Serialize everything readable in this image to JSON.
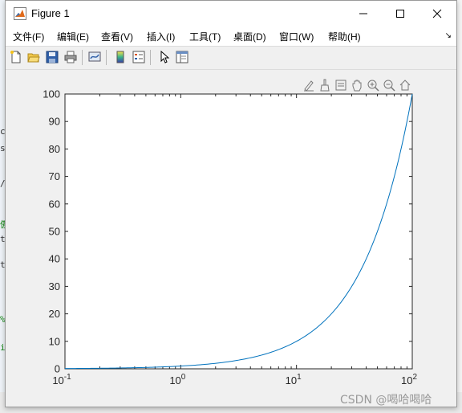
{
  "window": {
    "title": "Figure 1",
    "buttons": {
      "minimize_icon": "minimize-icon",
      "maximize_icon": "maximize-icon",
      "close_icon": "close-icon"
    }
  },
  "menubar": {
    "items": [
      {
        "label": "文件(F)"
      },
      {
        "label": "编辑(E)"
      },
      {
        "label": "查看(V)"
      },
      {
        "label": "插入(I)"
      },
      {
        "label": "工具(T)"
      },
      {
        "label": "桌面(D)"
      },
      {
        "label": "窗口(W)"
      },
      {
        "label": "帮助(H)"
      }
    ]
  },
  "toolbar": {
    "icons": [
      "new-figure-icon",
      "open-file-icon",
      "save-icon",
      "print-icon",
      "link-plot-icon",
      "colorbar-icon",
      "legend-icon",
      "pointer-icon",
      "property-editor-icon"
    ]
  },
  "axes_toolbar": {
    "icons": [
      "edit-icon",
      "brush-icon",
      "data-tip-icon",
      "pan-icon",
      "zoom-in-icon",
      "zoom-out-icon",
      "home-icon"
    ]
  },
  "chart_data": {
    "type": "line",
    "xscale": "log",
    "xlim": [
      0.1,
      100
    ],
    "ylim": [
      0,
      100
    ],
    "x_ticks": [
      {
        "base": "10",
        "exp": "-1",
        "value": 0.1
      },
      {
        "base": "10",
        "exp": "0",
        "value": 1
      },
      {
        "base": "10",
        "exp": "1",
        "value": 10
      },
      {
        "base": "10",
        "exp": "2",
        "value": 100
      }
    ],
    "y_ticks": [
      "0",
      "10",
      "20",
      "30",
      "40",
      "50",
      "60",
      "70",
      "80",
      "90",
      "100"
    ],
    "series": [
      {
        "color": "#0072bd",
        "x": [
          0.1,
          1,
          10,
          100
        ],
        "y": [
          0.1,
          1,
          10,
          100
        ]
      }
    ],
    "grid": false,
    "background": "#ffffff"
  },
  "watermark": "CSDN @喝哈喝哈",
  "background_fragments": [
    "c",
    "st",
    "/",
    "傲",
    "t",
    "t",
    "%",
    "ie"
  ]
}
